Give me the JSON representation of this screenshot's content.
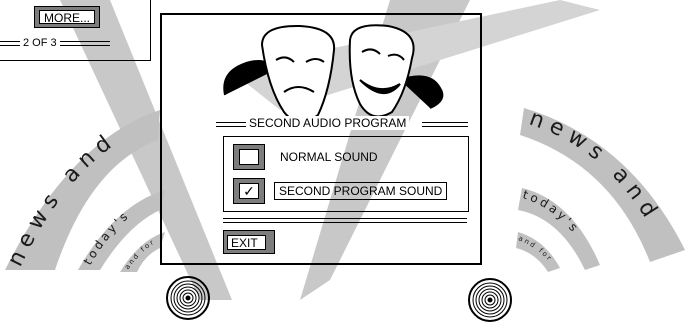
{
  "navigation": {
    "more_label": "MORE...",
    "page_indicator": "2 OF 3"
  },
  "panel": {
    "title": "SECOND AUDIO PROGRAM",
    "options": [
      {
        "label": "NORMAL SOUND",
        "checked": false,
        "selected": false
      },
      {
        "label": "SECOND PROGRAM SOUND",
        "checked": true,
        "selected": true
      }
    ],
    "checkmark": "✓",
    "exit_label": "EXIT"
  },
  "decor": {
    "left_big": "news and",
    "left_mid": "today's",
    "left_small": "and for",
    "right_big": "news and",
    "right_mid": "today's",
    "right_small": "and for"
  },
  "colors": {
    "beam": "#c8c8c8",
    "button_face": "#7d7d7d",
    "ink": "#000000"
  },
  "icons": [
    "theater-masks-icon",
    "speaker-left-icon",
    "speaker-right-icon"
  ]
}
